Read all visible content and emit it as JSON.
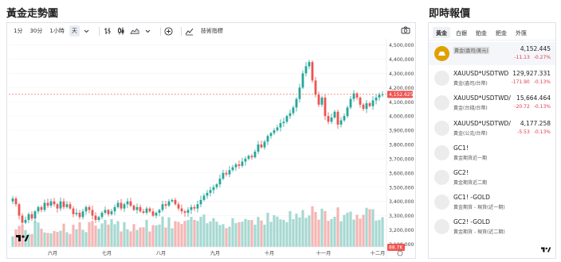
{
  "left_title": "黃金走勢圖",
  "right_title": "即時報價",
  "toolbar": {
    "intervals": [
      "1分",
      "30分",
      "1小時",
      "天"
    ],
    "active_interval": "天",
    "indicators_label": "技術指標"
  },
  "chart_data": {
    "type": "candlestick",
    "x_tick_labels": [
      "六月",
      "七月",
      "八月",
      "九月",
      "十月",
      "十一月",
      "十二月"
    ],
    "y_tick_labels": [
      "4,500,000",
      "4,400,000",
      "4,300,000",
      "4,200,000",
      "4,100,000",
      "4,000,000",
      "3,900,000",
      "3,800,000",
      "3,700,000",
      "3,600,000",
      "3,500,000",
      "3,400,000",
      "3,300,000",
      "3,200,000",
      "3,100,000"
    ],
    "ylim": [
      3080000,
      4520000
    ],
    "closes": [
      3420000,
      3380000,
      3300000,
      3250000,
      3270000,
      3310000,
      3280000,
      3330000,
      3360000,
      3340000,
      3390000,
      3370000,
      3400000,
      3380000,
      3350000,
      3400000,
      3360000,
      3380000,
      3350000,
      3310000,
      3320000,
      3290000,
      3330000,
      3360000,
      3340000,
      3300000,
      3270000,
      3290000,
      3320000,
      3340000,
      3310000,
      3330000,
      3360000,
      3390000,
      3350000,
      3380000,
      3400000,
      3370000,
      3340000,
      3360000,
      3330000,
      3320000,
      3350000,
      3330000,
      3300000,
      3320000,
      3340000,
      3380000,
      3370000,
      3400000,
      3410000,
      3380000,
      3350000,
      3330000,
      3320000,
      3340000,
      3360000,
      3350000,
      3380000,
      3410000,
      3440000,
      3460000,
      3480000,
      3500000,
      3520000,
      3560000,
      3600000,
      3590000,
      3620000,
      3640000,
      3660000,
      3650000,
      3680000,
      3700000,
      3720000,
      3710000,
      3750000,
      3800000,
      3780000,
      3820000,
      3860000,
      3880000,
      3900000,
      3920000,
      3950000,
      3960000,
      4000000,
      4020000,
      4060000,
      4120000,
      4200000,
      4300000,
      4350000,
      4380000,
      4250000,
      4150000,
      4080000,
      4130000,
      4000000,
      3960000,
      3990000,
      4030000,
      3940000,
      3970000,
      4000000,
      4060000,
      4120000,
      4160000,
      4130000,
      4080000,
      4050000,
      4090000,
      4070000,
      4110000,
      4130000,
      4150000,
      4152445
    ],
    "current_price_label": "4,152.625",
    "volume_label": "88.7K",
    "up_color": "#26a69a",
    "down_color": "#ef5350"
  },
  "quotes": {
    "tabs": [
      "黃金",
      "白銀",
      "鉑金",
      "鈀金",
      "外匯"
    ],
    "active_tab": "黃金",
    "rows": [
      {
        "name": "",
        "desc": "黃金(盎司/美元)",
        "price": "4,152.445",
        "change": "-11.13",
        "pct": "-0.27%",
        "icon": "gold-bar-icon"
      },
      {
        "name": "XAUUSD*USDTWD",
        "desc": "黃金(盎司/台幣)",
        "price": "129,927.331",
        "change": "-171.90",
        "pct": "-0.13%",
        "icon": "commodity-icon"
      },
      {
        "name": "XAUUSD*USDTWD/",
        "desc": "黃金(台錢/台幣)",
        "price": "15,664.464",
        "change": "-20.72",
        "pct": "-0.13%",
        "icon": "commodity-icon"
      },
      {
        "name": "XAUUSD*USDTWD/",
        "desc": "黃金(公克/台幣)",
        "price": "4,177.258",
        "change": "-5.53",
        "pct": "-0.13%",
        "icon": "commodity-icon"
      },
      {
        "name": "GC1!",
        "desc": "黃金期貨近一期",
        "price": "",
        "change": "",
        "pct": "",
        "icon": "commodity-icon"
      },
      {
        "name": "GC2!",
        "desc": "黃金期貨近二期",
        "price": "",
        "change": "",
        "pct": "",
        "icon": "commodity-icon"
      },
      {
        "name": "GC1! -GOLD",
        "desc": "黃金期貨 - 現貨(近一期)",
        "price": "",
        "change": "",
        "pct": "",
        "icon": "commodity-icon"
      },
      {
        "name": "GC2! -GOLD",
        "desc": "黃金期貨 - 現貨(近二期)",
        "price": "",
        "change": "",
        "pct": "",
        "icon": "commodity-icon"
      }
    ]
  },
  "logo_text": "TV"
}
